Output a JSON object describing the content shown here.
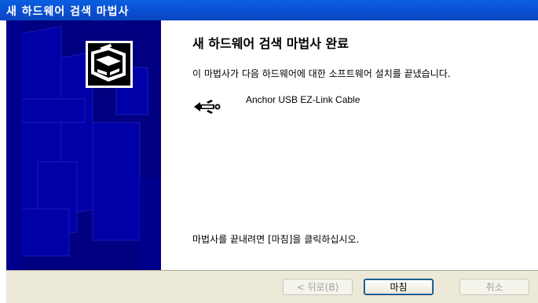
{
  "window": {
    "title": "새 하드웨어 검색 마법사"
  },
  "content": {
    "heading": "새 하드웨어 검색 마법사 완료",
    "description": "이 마법사가 다음 하드웨어에 대한 소프트웨어 설치를 끝냈습니다.",
    "device_name": "Anchor USB EZ-Link Cable",
    "device_icon": "usb-icon",
    "finish_prompt": "마법사를 끝내려면 [마침]을 클릭하십시오."
  },
  "buttons": {
    "back": "< 뒤로(B)",
    "finish": "마침",
    "cancel": "취소"
  },
  "colors": {
    "titlebar": "#0b4fd1",
    "sidebar": "#000080",
    "footer": "#ece9d8"
  }
}
